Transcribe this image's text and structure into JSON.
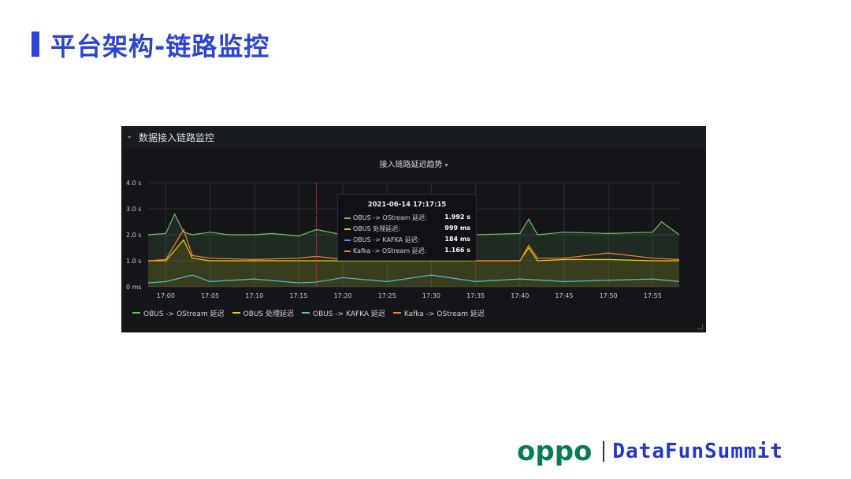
{
  "page": {
    "title": "平台架构-链路监控"
  },
  "panel": {
    "header_title": "数据接入链路监控",
    "chart_title": "接入链路延迟趋势",
    "tooltip": {
      "time": "2021-06-14 17:17:15",
      "rows": [
        {
          "label": "OBUS -> OStream 延迟:",
          "value": "1.992 s",
          "color": "#73bf69"
        },
        {
          "label": "OBUS 处理延迟:",
          "value": "999 ms",
          "color": "#f2cc0c"
        },
        {
          "label": "OBUS -> KAFKA 延迟:",
          "value": "184 ms",
          "color": "#5794f2"
        },
        {
          "label": "Kafka -> OStream 延迟:",
          "value": "1.166 s",
          "color": "#ff7f30"
        }
      ]
    },
    "legend": [
      {
        "name": "OBUS -> OStream 延迟",
        "color": "#73bf69"
      },
      {
        "name": "OBUS 处理延迟",
        "color": "#f2cc0c"
      },
      {
        "name": "OBUS -> KAFKA 延迟",
        "color": "#56c2d6"
      },
      {
        "name": "Kafka -> OStream 延迟",
        "color": "#ff7f30"
      }
    ]
  },
  "chart_data": {
    "type": "line",
    "title": "接入链路延迟趋势",
    "y_tick_labels": [
      "0 ms",
      "1.0 s",
      "2.0 s",
      "3.0 s",
      "4.0 s"
    ],
    "ylim": [
      0,
      4
    ],
    "x_tick_labels": [
      "17:00",
      "17:05",
      "17:10",
      "17:15",
      "17:20",
      "17:25",
      "17:30",
      "17:35",
      "17:40",
      "17:45",
      "17:50",
      "17:55"
    ],
    "xlim": [
      "16:58",
      "17:58"
    ],
    "grid": true,
    "legend_position": "bottom",
    "cursor_time": "17:17",
    "series": [
      {
        "name": "OBUS -> OStream 延迟",
        "color": "#73bf69",
        "fill": true,
        "x": [
          "16:58",
          "17:00",
          "17:01",
          "17:02",
          "17:03",
          "17:05",
          "17:07",
          "17:10",
          "17:12",
          "17:15",
          "17:17",
          "17:20",
          "17:25",
          "17:30",
          "17:35",
          "17:40",
          "17:41",
          "17:42",
          "17:45",
          "17:50",
          "17:55",
          "17:56",
          "17:58"
        ],
        "values": [
          2.0,
          2.05,
          2.8,
          2.1,
          2.0,
          2.1,
          2.0,
          2.0,
          2.05,
          1.95,
          2.2,
          2.0,
          2.0,
          2.0,
          2.0,
          2.05,
          2.6,
          2.0,
          2.1,
          2.05,
          2.1,
          2.5,
          2.0
        ]
      },
      {
        "name": "OBUS 处理延迟",
        "color": "#f2cc0c",
        "fill": true,
        "x": [
          "16:58",
          "17:00",
          "17:02",
          "17:03",
          "17:05",
          "17:10",
          "17:15",
          "17:17",
          "17:20",
          "17:25",
          "17:30",
          "17:35",
          "17:40",
          "17:41",
          "17:42",
          "17:45",
          "17:50",
          "17:55",
          "17:58"
        ],
        "values": [
          1.0,
          1.0,
          1.8,
          1.1,
          1.0,
          1.0,
          1.0,
          1.0,
          1.0,
          1.0,
          1.0,
          1.0,
          1.0,
          1.5,
          1.0,
          1.05,
          1.05,
          1.0,
          1.0
        ]
      },
      {
        "name": "OBUS -> KAFKA 延迟",
        "color": "#56c2d6",
        "fill": false,
        "x": [
          "16:58",
          "17:00",
          "17:03",
          "17:05",
          "17:10",
          "17:15",
          "17:17",
          "17:20",
          "17:25",
          "17:30",
          "17:35",
          "17:40",
          "17:45",
          "17:50",
          "17:55",
          "17:58"
        ],
        "values": [
          0.15,
          0.2,
          0.45,
          0.2,
          0.3,
          0.15,
          0.18,
          0.35,
          0.2,
          0.45,
          0.2,
          0.3,
          0.2,
          0.25,
          0.3,
          0.2
        ]
      },
      {
        "name": "Kafka -> OStream 延迟",
        "color": "#ff7f30",
        "fill": false,
        "x": [
          "16:58",
          "17:00",
          "17:02",
          "17:03",
          "17:05",
          "17:10",
          "17:15",
          "17:17",
          "17:20",
          "17:25",
          "17:30",
          "17:35",
          "17:40",
          "17:41",
          "17:42",
          "17:45",
          "17:50",
          "17:55",
          "17:58"
        ],
        "values": [
          1.0,
          1.05,
          2.2,
          1.2,
          1.1,
          1.05,
          1.1,
          1.17,
          1.05,
          1.05,
          1.1,
          1.0,
          1.0,
          1.6,
          1.1,
          1.1,
          1.3,
          1.1,
          1.05
        ]
      }
    ]
  },
  "brand": {
    "oppo": "oppo",
    "summit": "DataFunSummit",
    "oppo_color": "#0a7a55",
    "summit_color": "#2236c8"
  }
}
